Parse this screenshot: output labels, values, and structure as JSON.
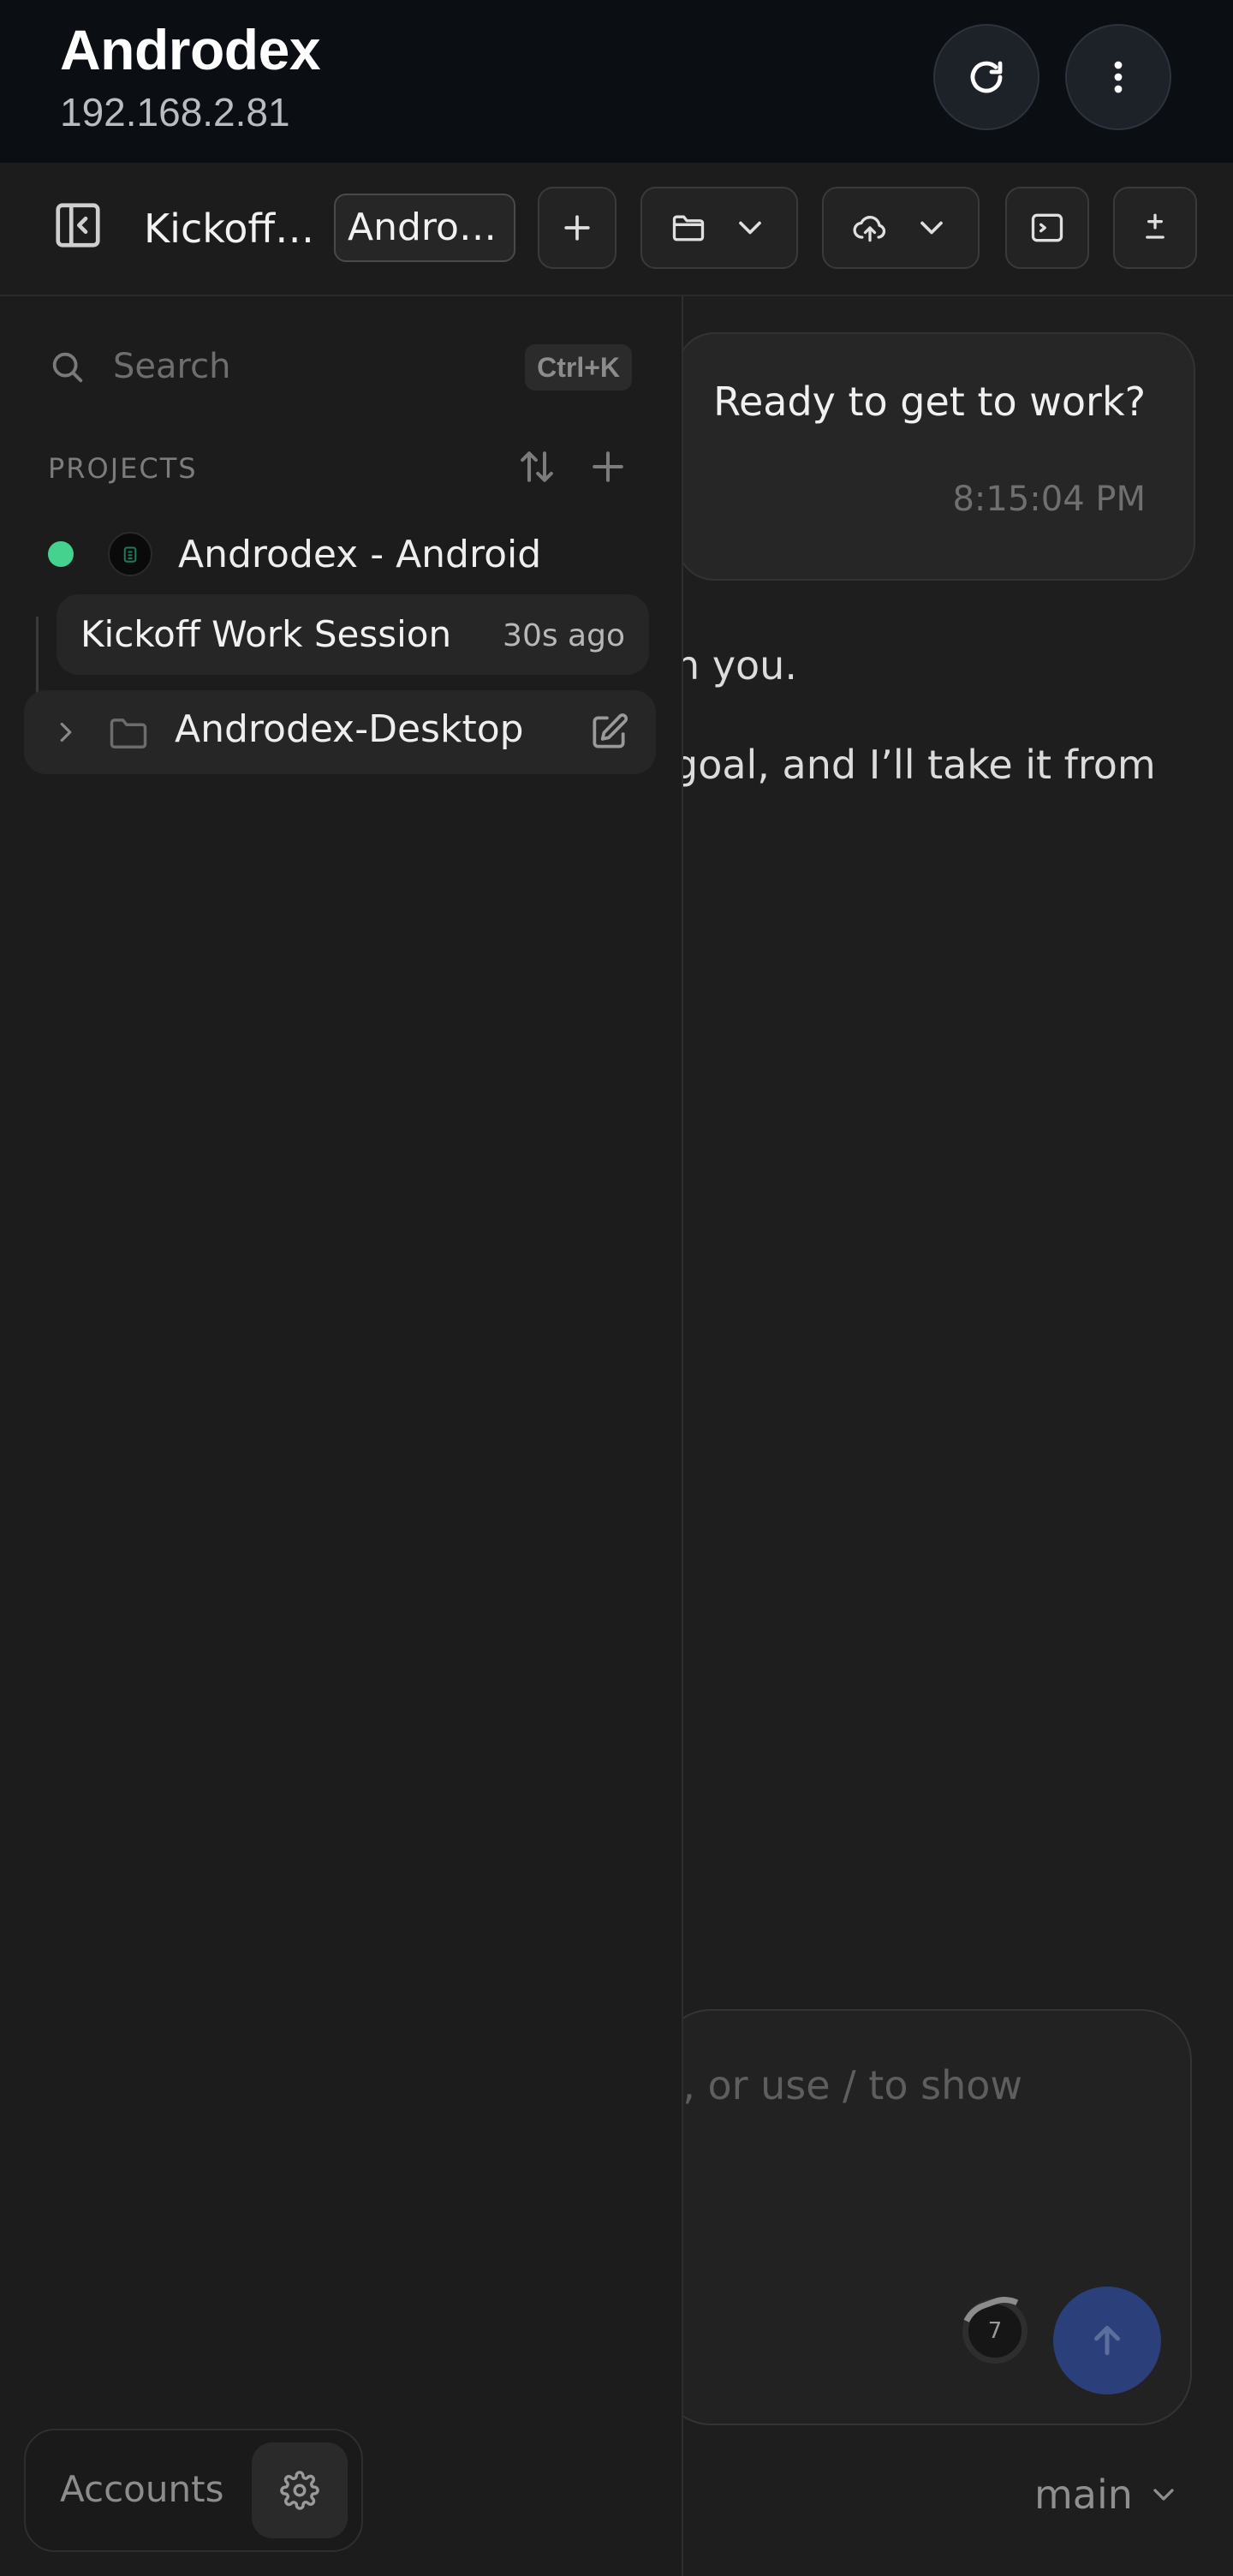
{
  "app_bar": {
    "title": "Androdex",
    "subtitle": "192.168.2.81",
    "actions": [
      {
        "name": "refresh-icon"
      },
      {
        "name": "more-vertical-icon"
      }
    ]
  },
  "toolbar": {
    "sidebar_toggle_icon": "sidebar-collapse-icon",
    "thread_title": "Kickoff Work Session",
    "project_chip": "Androdex - Android",
    "buttons": [
      "plus-icon",
      "folder-icon",
      "cloud-upload-icon",
      "terminal-icon",
      "diff-plus-minus-icon"
    ]
  },
  "chat": {
    "user_message": "Ready to get to work?",
    "user_time": "8:15:04 PM",
    "assistant_line_1": "th you.",
    "assistant_line_2": "goal, and I’ll take it from",
    "composer_placeholder": "s, or use / to show",
    "context_count": "7",
    "branch": "main",
    "accent_color": "#2b407a"
  },
  "sidebar": {
    "search_placeholder": "Search",
    "search_shortcut": "Ctrl+K",
    "section_label": "PROJECTS",
    "projects": [
      {
        "name": "Androdex - Android",
        "status_color": "#45d28f",
        "threads": [
          {
            "title": "Kickoff Work Session",
            "age": "30s ago"
          }
        ]
      },
      {
        "name": "Androdex-Desktop"
      }
    ],
    "accounts_label": "Accounts"
  }
}
